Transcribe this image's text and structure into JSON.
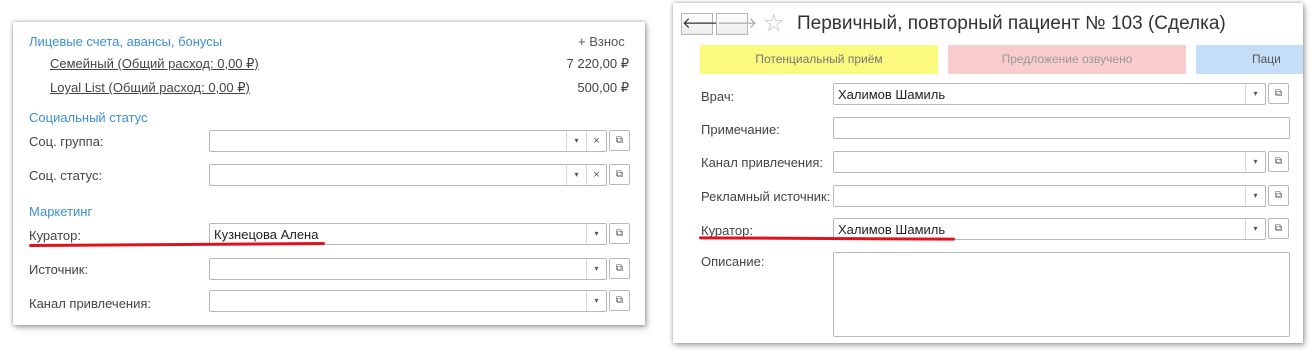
{
  "left": {
    "accounts": {
      "title": "Лицевые счета, авансы, бонусы",
      "add_label": "+ Взнос",
      "items": [
        {
          "name": "Семейный (Общий расход: 0,00 ₽)",
          "amount": "7 220,00 ₽"
        },
        {
          "name": "Loyal List (Общий расход: 0,00 ₽)",
          "amount": "500,00 ₽"
        }
      ]
    },
    "social": {
      "title": "Социальный статус",
      "group_label": "Соц. группа:",
      "group_value": "",
      "status_label": "Соц. статус:",
      "status_value": ""
    },
    "marketing": {
      "title": "Маркетинг",
      "curator_label": "Куратор:",
      "curator_value": "Кузнецова Алена",
      "source_label": "Источник:",
      "source_value": "",
      "channel_label": "Канал привлечения:",
      "channel_value": ""
    }
  },
  "right": {
    "title": "Первичный, повторный пациент № 103 (Сделка)",
    "stages": [
      {
        "label": "Потенциальный приём",
        "color": "#fbf97e",
        "text_color": "#777777"
      },
      {
        "label": "Предложение озвучено",
        "color": "#f9cdcd",
        "text_color": "#999999"
      },
      {
        "label": "Паци",
        "color": "#c5def8",
        "text_color": "#555555"
      }
    ],
    "fields": {
      "doctor_label": "Врач:",
      "doctor_value": "Халимов Шамиль",
      "note_label": "Примечание:",
      "note_value": "",
      "channel_label": "Канал привлечения:",
      "channel_value": "",
      "ad_source_label": "Рекламный источник:",
      "ad_source_value": "",
      "curator_label": "Куратор:",
      "curator_value": "Халимов Шамиль",
      "description_label": "Описание:",
      "description_value": ""
    }
  },
  "icons": {
    "dropdown": "▾",
    "clear": "×",
    "open": "⧉",
    "back": "🡐",
    "forward": "🡒",
    "star": "☆"
  },
  "colors": {
    "section_title": "#3d8fd4",
    "highlight_line": "#e2121d"
  }
}
